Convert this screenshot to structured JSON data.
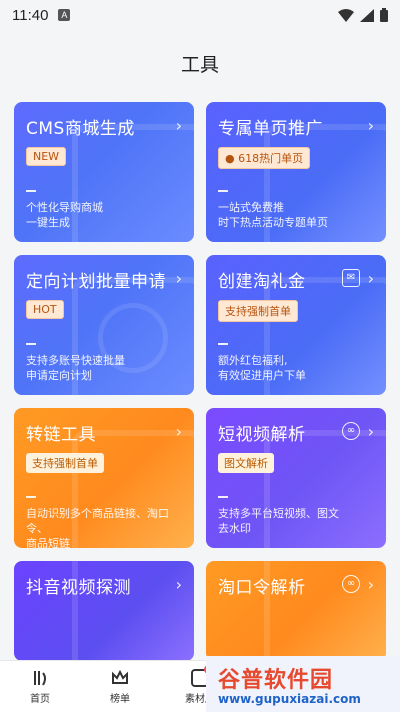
{
  "status_bar": {
    "time": "11:40",
    "indicator": "A"
  },
  "page": {
    "title": "工具"
  },
  "cards": [
    {
      "title": "CMS商城生成",
      "badge": "NEW",
      "desc": [
        "个性化导购商城",
        "一键生成"
      ]
    },
    {
      "title": "专属单页推广",
      "badge": "618热门单页",
      "desc": [
        "一站式免费推",
        "时下热点活动专题单页"
      ]
    },
    {
      "title": "定向计划批量申请",
      "badge": "HOT",
      "desc": [
        "支持多账号快速批量",
        "申请定向计划"
      ]
    },
    {
      "title": "创建淘礼金",
      "badge": "支持强制首单",
      "desc": [
        "额外红包福利,",
        "有效促进用户下单"
      ]
    },
    {
      "title": "转链工具",
      "badge": "支持强制首单",
      "desc": [
        "自动识别多个商品链接、淘口令、",
        "商品短链"
      ]
    },
    {
      "title": "短视频解析",
      "badge": "图文解析",
      "desc": [
        "支持多平台短视频、图文",
        "去水印"
      ]
    },
    {
      "title": "抖音视频探测"
    },
    {
      "title": "淘口令解析"
    }
  ],
  "bottom_nav": [
    {
      "label": "首页",
      "icon": "home-icon"
    },
    {
      "label": "榜单",
      "icon": "crown-icon"
    },
    {
      "label": "素材库",
      "icon": "library-icon"
    }
  ],
  "watermark": {
    "title": "谷普软件园",
    "url": "www.gupuxiazai.com"
  }
}
